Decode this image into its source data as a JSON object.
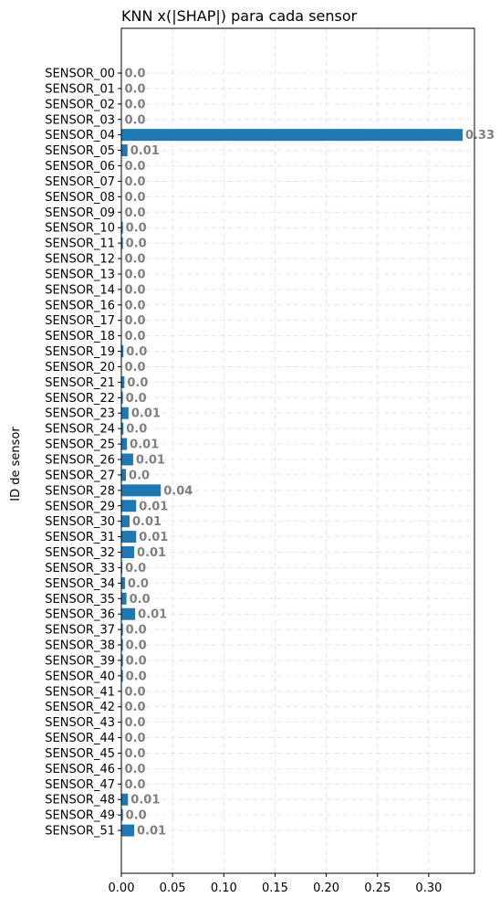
{
  "chart_data": {
    "type": "bar",
    "orientation": "horizontal",
    "title": "KNN x(|SHAP|) para cada sensor",
    "xlabel": "",
    "ylabel": "ID de sensor",
    "xlim": [
      0,
      0.35
    ],
    "xticks": [
      "0.00",
      "0.05",
      "0.10",
      "0.15",
      "0.20",
      "0.25",
      "0.30"
    ],
    "grid": true,
    "bar_color": "#1f77b4",
    "label_color": "#808080",
    "categories": [
      "SENSOR_00",
      "SENSOR_01",
      "SENSOR_02",
      "SENSOR_03",
      "SENSOR_04",
      "SENSOR_05",
      "SENSOR_06",
      "SENSOR_07",
      "SENSOR_08",
      "SENSOR_09",
      "SENSOR_10",
      "SENSOR_11",
      "SENSOR_12",
      "SENSOR_13",
      "SENSOR_14",
      "SENSOR_16",
      "SENSOR_17",
      "SENSOR_18",
      "SENSOR_19",
      "SENSOR_20",
      "SENSOR_21",
      "SENSOR_22",
      "SENSOR_23",
      "SENSOR_24",
      "SENSOR_25",
      "SENSOR_26",
      "SENSOR_27",
      "SENSOR_28",
      "SENSOR_29",
      "SENSOR_30",
      "SENSOR_31",
      "SENSOR_32",
      "SENSOR_33",
      "SENSOR_34",
      "SENSOR_35",
      "SENSOR_36",
      "SENSOR_37",
      "SENSOR_38",
      "SENSOR_39",
      "SENSOR_40",
      "SENSOR_41",
      "SENSOR_42",
      "SENSOR_43",
      "SENSOR_44",
      "SENSOR_45",
      "SENSOR_46",
      "SENSOR_47",
      "SENSOR_48",
      "SENSOR_49",
      "SENSOR_51"
    ],
    "values": [
      0.0,
      0.0,
      0.0,
      0.0,
      0.333,
      0.006,
      0.0,
      0.0,
      0.0,
      0.0,
      0.0015,
      0.0015,
      0.0,
      0.0,
      0.0,
      0.0,
      0.0,
      0.0,
      0.002,
      0.0,
      0.003,
      0.0015,
      0.007,
      0.002,
      0.0055,
      0.0115,
      0.0045,
      0.0385,
      0.0145,
      0.008,
      0.0145,
      0.0125,
      0.001,
      0.0035,
      0.005,
      0.0135,
      0.0015,
      0.0015,
      0.0015,
      0.0015,
      0.0005,
      0.0005,
      0.0005,
      0.0005,
      0.0005,
      0.0005,
      0.0005,
      0.0065,
      0.0015,
      0.0125
    ],
    "data_labels": [
      "0.0",
      "0.0",
      "0.0",
      "0.0",
      "0.33",
      "0.01",
      "0.0",
      "0.0",
      "0.0",
      "0.0",
      "0.0",
      "0.0",
      "0.0",
      "0.0",
      "0.0",
      "0.0",
      "0.0",
      "0.0",
      "0.0",
      "0.0",
      "0.0",
      "0.0",
      "0.01",
      "0.0",
      "0.01",
      "0.01",
      "0.0",
      "0.04",
      "0.01",
      "0.01",
      "0.01",
      "0.01",
      "0.0",
      "0.0",
      "0.0",
      "0.01",
      "0.0",
      "0.0",
      "0.0",
      "0.0",
      "0.0",
      "0.0",
      "0.0",
      "0.0",
      "0.0",
      "0.0",
      "0.0",
      "0.01",
      "0.0",
      "0.01"
    ]
  }
}
